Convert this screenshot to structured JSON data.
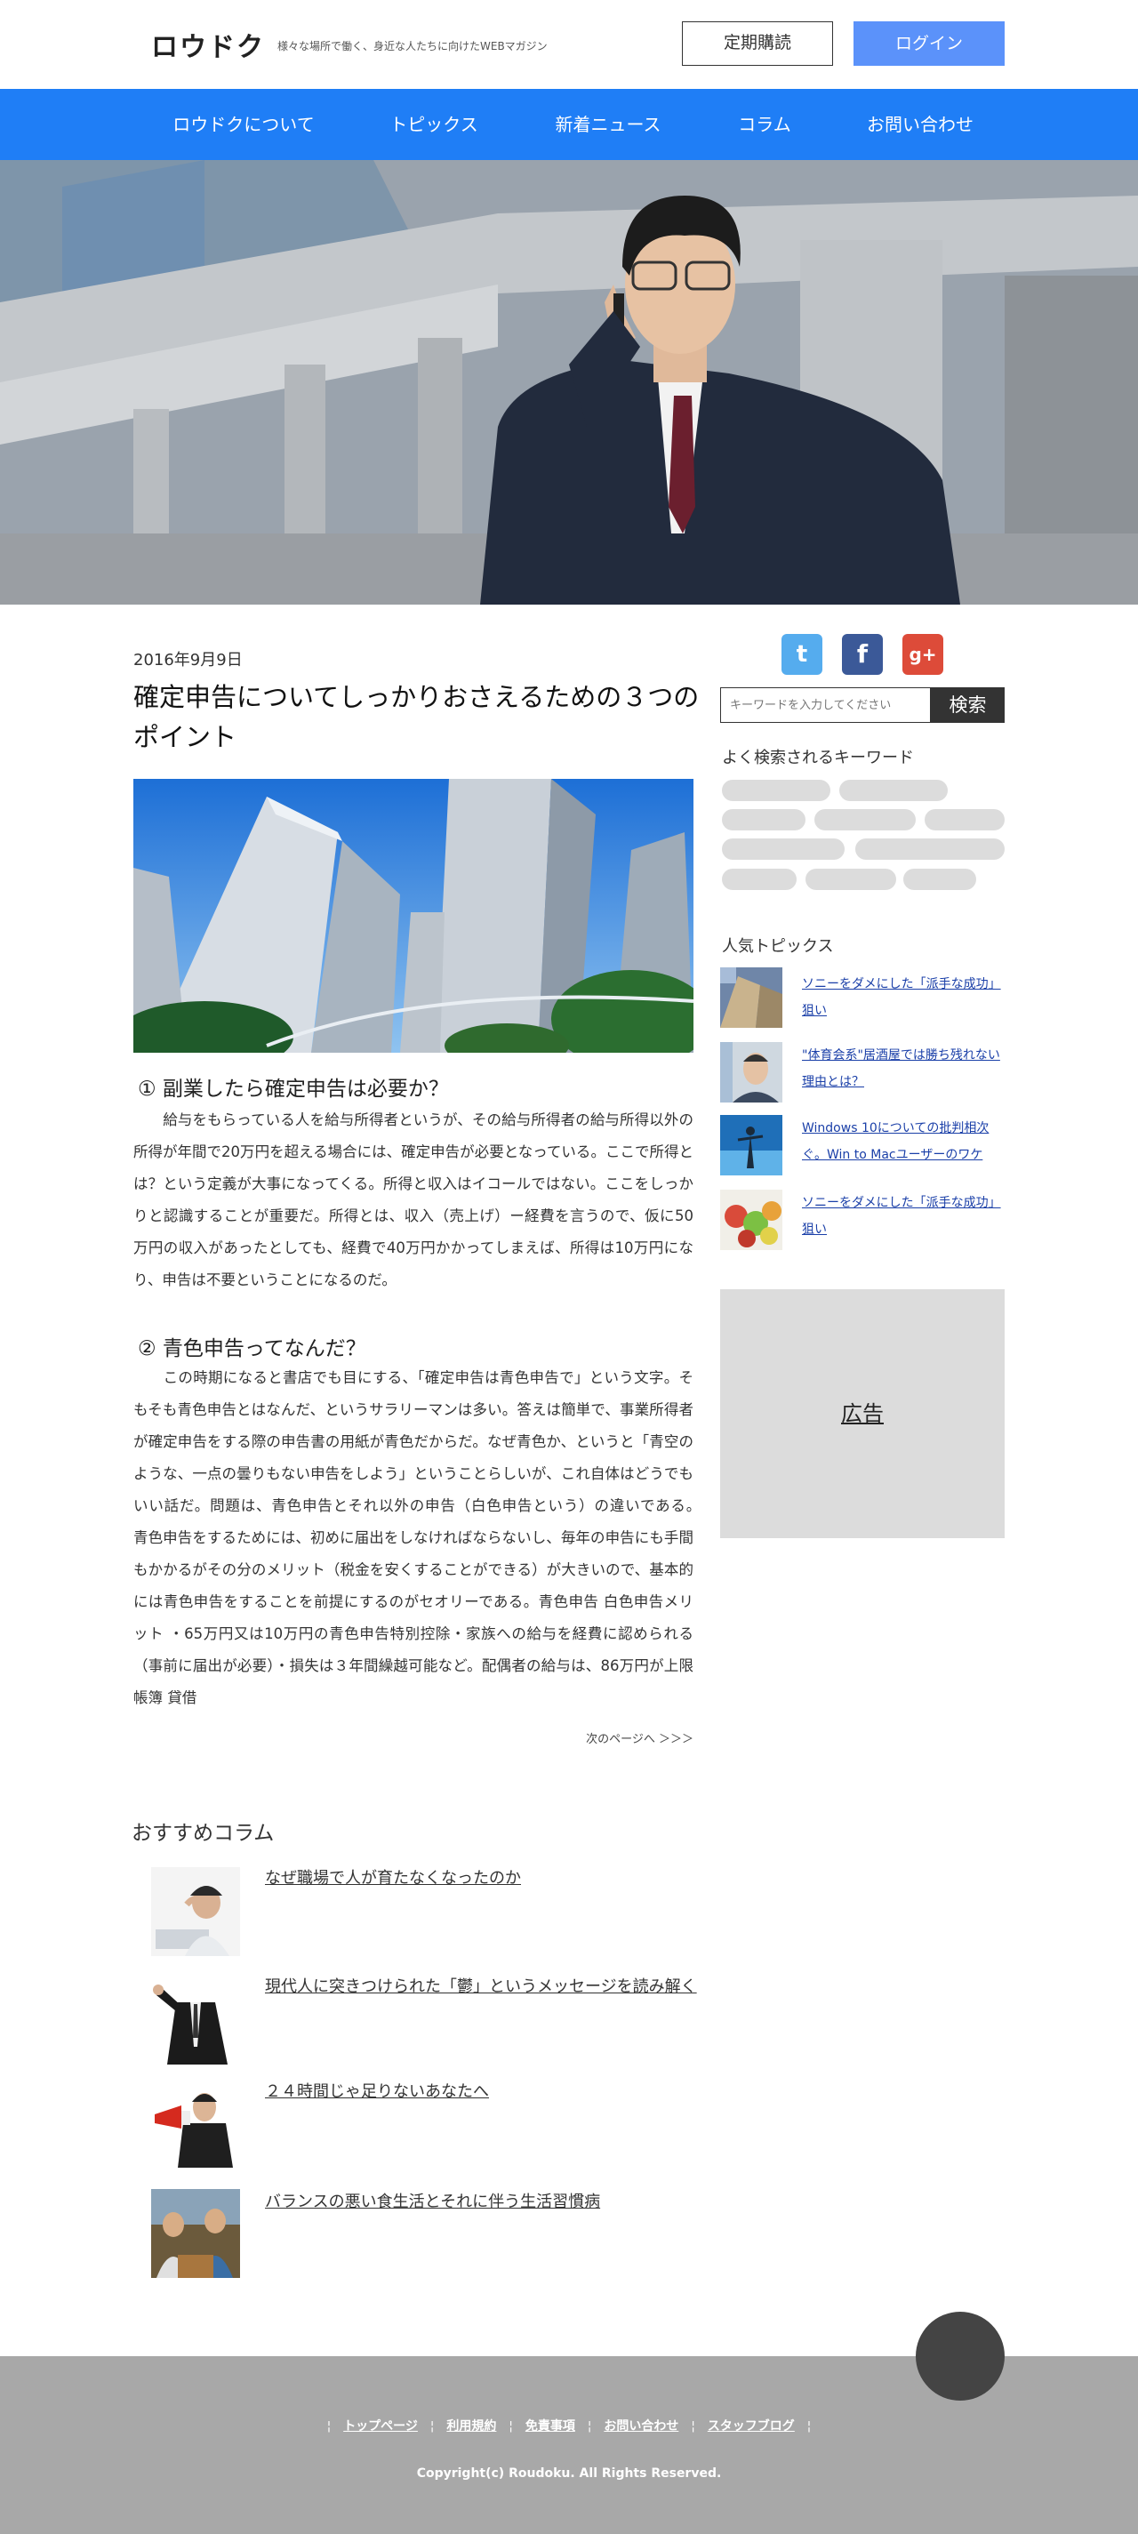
{
  "header": {
    "logo": "ロウドク",
    "tagline": "様々な場所で働く、身近な人たちに向けたWEBマガジン",
    "subscribe_label": "定期購読",
    "login_label": "ログイン"
  },
  "nav": {
    "items": [
      "ロウドクについて",
      "トピックス",
      "新着ニュース",
      "コラム",
      "お問い合わせ"
    ]
  },
  "colors": {
    "accent": "#1f7ef6",
    "login_button": "#5b92fa",
    "footer": "#a8a8a8",
    "twitter": "#55acee",
    "facebook": "#3b5998",
    "google_plus": "#dd4b39"
  },
  "article": {
    "date": "2016年9月9日",
    "title": "確定申告についてしっかりおさえるための３つのポイント",
    "section1": {
      "heading": "① 副業したら確定申告は必要か？",
      "body": "　　給与をもらっている人を給与所得者というが、その給与所得者の給与所得以外の所得が年間で20万円を超える場合には、確定申告が必要となっている。ここで所得とは？という定義が大事になってくる。所得と収入はイコールではない。ここをしっかりと認識することが重要だ。所得とは、収入（売上げ）ー経費を言うので、仮に50万円の収入があったとしても、経費で40万円かかってしまえば、所得は10万円になり、申告は不要ということになるのだ。"
    },
    "section2": {
      "heading": "② 青色申告ってなんだ？",
      "body": "　　この時期になると書店でも目にする、「確定申告は青色申告で」という文字。そもそも青色申告とはなんだ、というサラリーマンは多い。答えは簡単で、事業所得者が確定申告をする際の申告書の用紙が青色だからだ。なぜ青色か、というと「青空のような、一点の曇りもない申告をしよう」ということらしいが、これ自体はどうでもいい話だ。問題は、青色申告とそれ以外の申告（白色申告という）の違いである。　青色申告をするためには、初めに届出をしなければならないし、毎年の申告にも手間もかかるがその分のメリット（税金を安くすることができる）が大きいので、基本的には青色申告をすることを前提にするのがセオリーである。青色申告 白色申告メリット ・65万円又は10万円の青色申告特別控除・家族への給与を経費に認められる（事前に届出が必要）・損失は３年間繰越可能など。配偶者の給与は、86万円が上限帳簿 貸借"
    },
    "next_page": "次のページへ ＞＞＞"
  },
  "sidebar": {
    "social": [
      "twitter-icon",
      "facebook-icon",
      "google-plus-icon"
    ],
    "social_glyphs": {
      "twitter": "t",
      "facebook": "f",
      "google_plus": "g+"
    },
    "search_placeholder": "キーワードを入力してください",
    "search_button": "検索",
    "keywords_heading": "よく検索されるキーワード",
    "topics_heading": "人気トピックス",
    "topics": [
      "ソニーをダメにした「派手な成功」狙い",
      "\"体育会系\"居酒屋では勝ち残れない理由とは？",
      "Windows 10についての批判相次ぐ。Win to Macユーザーのワケ",
      "ソニーをダメにした「派手な成功」狙い"
    ],
    "ad_label": "広告"
  },
  "recommended": {
    "heading": "おすすめコラム",
    "items": [
      "なぜ職場で人が育たなくなったのか",
      "現代人に突きつけられた「鬱」というメッセージを読み解く",
      "２４時間じゃ足りないあなたへ",
      "バランスの悪い食生活とそれに伴う生活習慣病"
    ]
  },
  "footer": {
    "links": [
      "トップページ",
      "利用規約",
      "免責事項",
      "お問い合わせ",
      "スタッフブログ"
    ],
    "copyright": "Copyright(c) Roudoku. All Rights Reserved."
  }
}
